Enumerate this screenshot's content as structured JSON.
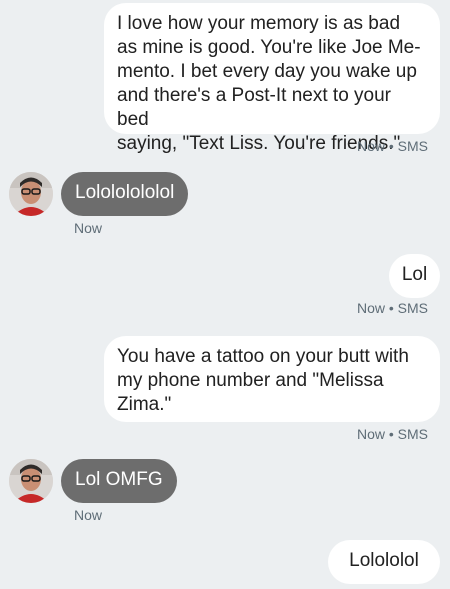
{
  "contact": {
    "avatar_icon": "contact-photo"
  },
  "messages": [
    {
      "direction": "sent",
      "text": "I love how your memory is as bad\nas mine is good. You're like Joe Me-\nmento. I bet every day you wake up\nand there's a Post-It next to your bed\nsaying, \"Text Liss. You're friends.\"",
      "time": "Now • SMS"
    },
    {
      "direction": "received",
      "text": "Lolololololol",
      "time": "Now"
    },
    {
      "direction": "sent",
      "text": "Lol",
      "time": "Now • SMS"
    },
    {
      "direction": "sent",
      "text": "You have a tattoo on your butt with\nmy phone number and \"Melissa\nZima.\"",
      "time": "Now • SMS"
    },
    {
      "direction": "received",
      "text": "Lol OMFG",
      "time": "Now"
    },
    {
      "direction": "sent",
      "text": "Lolololol",
      "time": ""
    }
  ],
  "colors": {
    "background": "#eceff1",
    "sent_bubble": "#ffffff",
    "received_bubble": "#6d6d6d",
    "meta_text": "#5f6d77"
  }
}
